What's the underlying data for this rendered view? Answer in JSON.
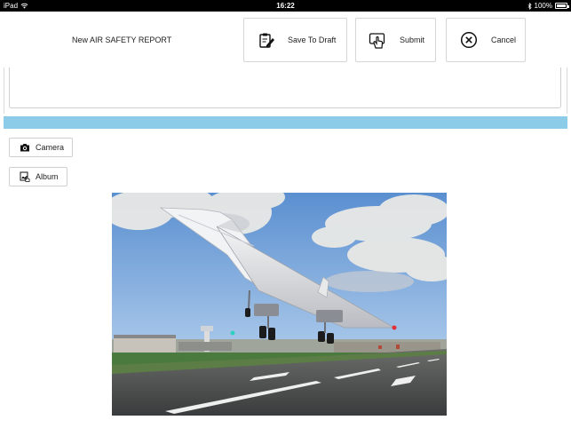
{
  "status_bar": {
    "device": "iPad",
    "time": "16:22",
    "battery": "100%"
  },
  "header": {
    "title": "New AIR SAFETY REPORT",
    "save_draft_label": "Save To Draft",
    "submit_label": "Submit",
    "cancel_label": "Cancel"
  },
  "attachments": {
    "camera_label": "Camera",
    "album_label": "Album"
  },
  "colors": {
    "accent_bar": "#8ccce8",
    "border": "#d6d6d6"
  },
  "icons": {
    "save_draft": "clipboard-edit-icon",
    "submit": "touch-submit-icon",
    "cancel": "close-circle-icon",
    "camera": "camera-icon",
    "album": "album-icon"
  }
}
